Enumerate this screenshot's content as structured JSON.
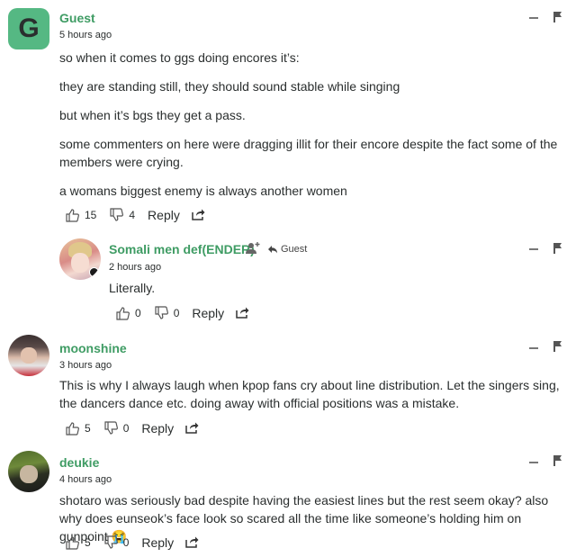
{
  "comments": [
    {
      "author": "Guest",
      "avatar_letter": "G",
      "time": "5 hours ago",
      "paragraphs": [
        "so when it comes to ggs doing encores it’s:",
        "they are standing still, they should sound stable while singing",
        "but when it’s bgs they get a pass.",
        "some commenters on here were dragging illit for their encore despite the fact some of the members were crying.",
        "a womans biggest enemy is always another women"
      ],
      "upvotes": "15",
      "downvotes": "4",
      "reply_label": "Reply"
    },
    {
      "author": "Somali men def(ENDER)",
      "reply_to": "Guest",
      "time": "2 hours ago",
      "paragraphs": [
        "Literally."
      ],
      "upvotes": "0",
      "downvotes": "0",
      "reply_label": "Reply"
    },
    {
      "author": "moonshine",
      "time": "3 hours ago",
      "paragraphs": [
        "This is why I always laugh when kpop fans cry about line distribution. Let the singers sing, the dancers dance etc. doing away with official positions was a mistake."
      ],
      "upvotes": "5",
      "downvotes": "0",
      "reply_label": "Reply"
    },
    {
      "author": "deukie",
      "time": "4 hours ago",
      "paragraphs": [
        "shotaro was seriously bad despite having the easiest lines but the rest seem okay? also why does eunseok’s face look so scared all the time like someone’s holding him on gunpoint 😭"
      ],
      "upvotes": "5",
      "downvotes": "0",
      "reply_label": "Reply"
    }
  ],
  "colors": {
    "author": "#3f9c64",
    "avatar_bg": "#55b883"
  }
}
